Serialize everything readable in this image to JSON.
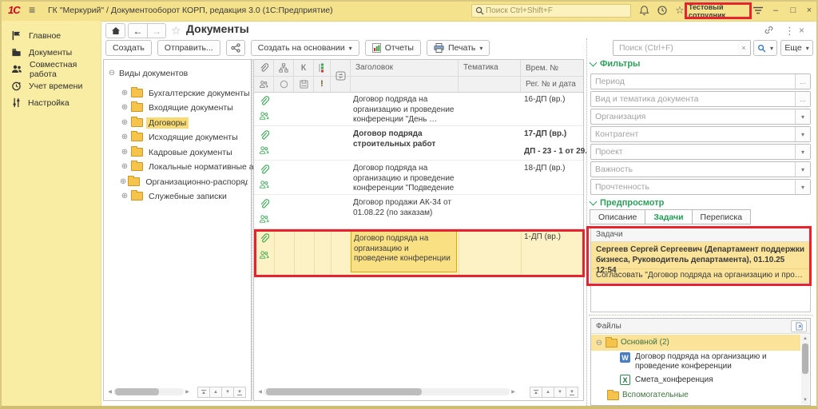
{
  "glyphs": {
    "hamburger": "≡",
    "back": "←",
    "forward": "→",
    "star": "☆",
    "kebab": "⋮",
    "close": "×",
    "minimize": "–",
    "maximize": "□",
    "combo": "▾",
    "ellipsis": "…",
    "plus": "⊕",
    "minus": "⊖",
    "clear": "×",
    "up": "▲",
    "down": "▼",
    "left": "◀",
    "right": "▶"
  },
  "topbar": {
    "logo": "1С",
    "title": "ГК \"Меркурий\" / Документооборот КОРП, редакция 3.0 (1С:Предприятие)",
    "search_placeholder": "Поиск Ctrl+Shift+F",
    "user": "Тестовый сотрудник"
  },
  "sidebar": {
    "items": [
      "Главное",
      "Документы",
      "Совместная работа",
      "Учет времени",
      "Настройка"
    ]
  },
  "page": {
    "title": "Документы"
  },
  "toolbar": {
    "create": "Создать",
    "send": "Отправить...",
    "create_based": "Создать на основании",
    "reports": "Отчеты",
    "print": "Печать"
  },
  "panel_toolbar": {
    "search_placeholder": "Поиск (Ctrl+F)",
    "more": "Еще"
  },
  "tree": {
    "root": "Виды документов",
    "items": [
      "Бухгалтерские документы",
      "Входящие документы",
      "Договоры",
      "Исходящие документы",
      "Кадровые документы",
      "Локальные нормативные акты",
      "Организационно-распорядительн",
      "Служебные записки"
    ]
  },
  "table": {
    "col_k": "К",
    "col_imp": "!",
    "col_title": "Заголовок",
    "col_subject": "Тематика",
    "col_temp": "Врем. №",
    "col_reg": "Рег. № и дата",
    "rows": [
      {
        "title": "Договор подряда на организацию и проведение конференции \"День …",
        "temp": "16-ДП (вр.)",
        "reg": ""
      },
      {
        "title": "Договор подряда строительных работ",
        "temp": "17-ДП (вр.)",
        "reg": "ДП - 23 - 1 от 29."
      },
      {
        "title": "Договор подряда на организацию и проведение конференции \"Подведение …",
        "temp": "18-ДП (вр.)",
        "reg": ""
      },
      {
        "title": "Договор продажи АК-34 от 01.08.22 (по заказам)",
        "temp": "",
        "reg": ""
      },
      {
        "title": "Договор подряда на организацию и проведение конференции",
        "temp": "1-ДП (вр.)",
        "reg": ""
      }
    ]
  },
  "filters": {
    "title": "Фильтры",
    "fields": [
      "Период",
      "Вид и тематика документа",
      "Организация",
      "Контрагент",
      "Проект",
      "Важность",
      "Прочтенность"
    ]
  },
  "preview": {
    "title": "Предпросмотр",
    "tabs": [
      "Описание",
      "Задачи",
      "Переписка"
    ],
    "tasks_header": "Задачи",
    "task_author": "Сергеев Сергей Сергеевич (Департамент поддержки бизнеса, Руководитель департамента), 01.10.25 12:54",
    "task_text": "Согласовать \"Договор подряда на организацию и проведение…"
  },
  "files": {
    "title": "Файлы",
    "main_folder": "Основной (2)",
    "file_word": "Договор подряда на организацию и проведение конференции",
    "file_excel": "Смета_конференция",
    "aux_folder": "Вспомогательные",
    "word_badge": "W",
    "excel_badge": "X"
  },
  "colors": {
    "accent_green": "#2da05c",
    "icon_green": "#3aa655",
    "annotation_red": "#e8232e",
    "topbar_yellow": "#f5e28c",
    "selection_yellow": "#f8e083"
  }
}
